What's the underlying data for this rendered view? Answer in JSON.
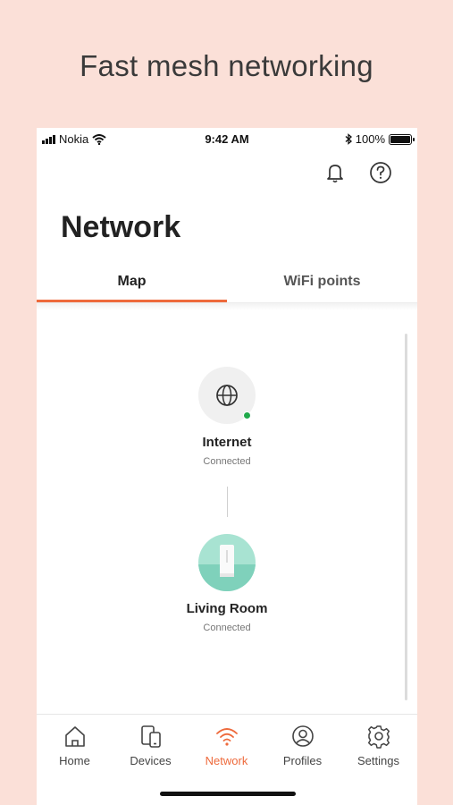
{
  "promo": {
    "title": "Fast mesh networking"
  },
  "status_bar": {
    "carrier": "Nokia",
    "time": "9:42 AM",
    "battery": "100%"
  },
  "header": {
    "title": "Network"
  },
  "tabs": [
    {
      "label": "Map",
      "active": true
    },
    {
      "label": "WiFi points",
      "active": false
    }
  ],
  "nodes": [
    {
      "name": "Internet",
      "status": "Connected",
      "icon": "globe-icon"
    },
    {
      "name": "Living Room",
      "status": "Connected",
      "icon": "router-icon"
    }
  ],
  "bottom_nav": [
    {
      "label": "Home",
      "icon": "home-icon",
      "active": false
    },
    {
      "label": "Devices",
      "icon": "devices-icon",
      "active": false
    },
    {
      "label": "Network",
      "icon": "wifi-icon",
      "active": true
    },
    {
      "label": "Profiles",
      "icon": "profile-icon",
      "active": false
    },
    {
      "label": "Settings",
      "icon": "gear-icon",
      "active": false
    }
  ],
  "colors": {
    "accent": "#ee6a3c",
    "background": "#fbe0d8",
    "online": "#1fa84a",
    "router_bg": "#a8e3d2"
  }
}
